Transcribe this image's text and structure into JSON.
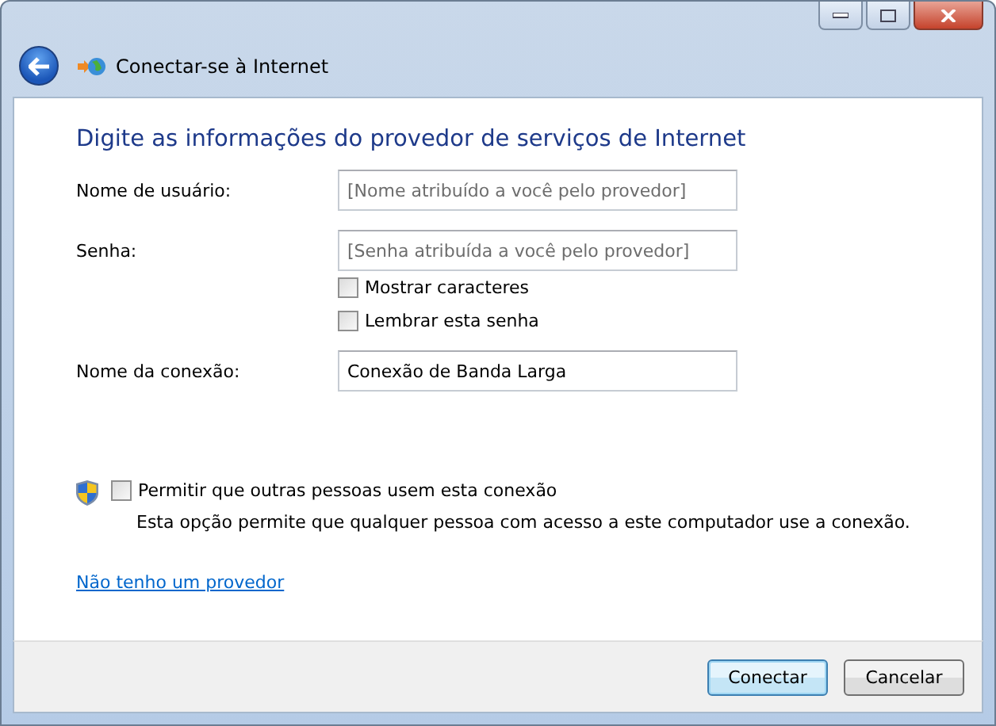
{
  "window": {
    "title": "Conectar-se à Internet"
  },
  "heading": "Digite as informações do provedor de serviços de Internet",
  "fields": [
    {
      "label": "Nome de usuário:",
      "placeholder": "[Nome atribuído a você pelo provedor]"
    },
    {
      "label": "Senha:",
      "placeholder": "[Senha atribuída a você pelo provedor]"
    },
    {
      "label": "Nome da conexão:",
      "value": "Conexão de Banda Larga"
    }
  ],
  "password_options": [
    {
      "label": "Mostrar caracteres",
      "checked": false
    },
    {
      "label": "Lembrar esta senha",
      "checked": false
    }
  ],
  "share": {
    "label": "Permitir que outras pessoas usem esta conexão",
    "checked": false,
    "description": "Esta opção permite que qualquer pessoa com acesso a este computador use a conexão."
  },
  "link": "Não tenho um provedor",
  "buttons": [
    {
      "label": "Conectar",
      "default": true
    },
    {
      "label": "Cancelar",
      "default": false
    }
  ]
}
